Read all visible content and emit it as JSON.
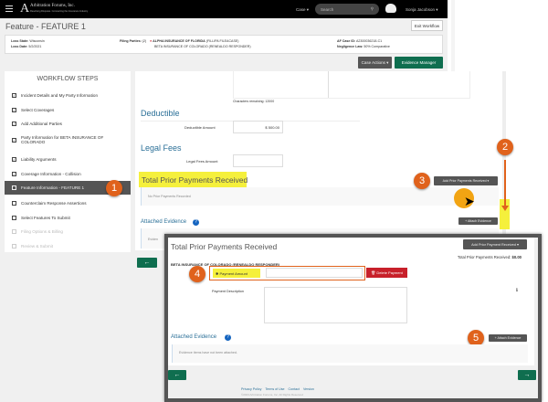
{
  "topbar": {
    "logo": "Arbitration Forums, Inc.",
    "tagline": "Resolving Disputes. Connecting the Insurance Industry",
    "case_menu": "Case ▾",
    "search_placeholder": "Search",
    "user": "Sonja Jacobson ▾"
  },
  "header": {
    "title": "Feature - FEATURE 1",
    "exit": "Exit Workflow"
  },
  "info": {
    "loss_state_label": "Loss State:",
    "loss_state": "Wisconsin",
    "loss_date_label": "Loss Date:",
    "loss_date": "5/2/2021",
    "filing_label": "Filing Parties:",
    "filing_count": "(2)",
    "party1": "ALPHA INSURANCE OF FLORIDA",
    "party1_rep": "(FILLIPA FILEACASE)",
    "party2": "BETA INSURANCE OF COLORADO",
    "party2_rep": "(RENEALDO RESPONDER)",
    "case_id_label": "AF Case ID:",
    "case_id": "A2300036218-C1",
    "negligence_label": "Negligence Law:",
    "negligence": "50% Comparative"
  },
  "actions": {
    "case_actions": "Case Actions ▾",
    "evidence_manager": "Evidence Manager"
  },
  "sidebar": {
    "title": "WORKFLOW STEPS",
    "items": [
      {
        "label": "Incident Details and My Party Information",
        "checked": true
      },
      {
        "label": "Select Coverages",
        "checked": true
      },
      {
        "label": "Add Additional Parties",
        "checked": true
      },
      {
        "label": "Party Information for BETA INSURANCE OF COLORADO",
        "checked": true
      },
      {
        "label": "Liability Arguments",
        "checked": true
      },
      {
        "label": "Coverage Information - Collision",
        "checked": true
      },
      {
        "label": "Feature Information - FEATURE 1",
        "checked": false,
        "active": true
      },
      {
        "label": "Counterclaim Response Assertions",
        "checked": false
      },
      {
        "label": "Select Features To Submit",
        "checked": false
      },
      {
        "label": "Filing Options & Billing",
        "checked": false,
        "disabled": true
      },
      {
        "label": "Review & Submit",
        "checked": false,
        "disabled": true
      }
    ]
  },
  "main": {
    "chars_remaining": "Characters remaining: 12000",
    "deductible": "Deductible",
    "deductible_amount_label": "Deductible Amount",
    "deductible_amount": "$ 500.00",
    "legal_fees": "Legal Fees",
    "legal_fees_label": "Legal Fees Amount",
    "prior_payments": "Total Prior Payments Received",
    "add_prior": "Add Prior Payments Received ▾",
    "no_prior": "No Prior Payments Recorded",
    "attached": "Attached Evidence",
    "attach_btn": "+ Attach Evidence",
    "evidence_stub": "Eviden"
  },
  "overlay": {
    "title": "Total Prior Payments Received",
    "add_prior": "Add Prior Payment Received ▾",
    "total_label": "Total Prior Payments Received:",
    "total": "$0.00",
    "party": "BETA INSURANCE OF COLORADO (RENEALDO RESPONDER)",
    "payment_amount": "Payment Amount",
    "delete": "Delete Payment",
    "payment_desc": "Payment Description",
    "attached": "Attached Evidence",
    "attach_btn": "+ Attach Evidence",
    "no_evidence": "Evidence items have not been attached.",
    "footer_links": [
      "Privacy Policy",
      "Terms of Use",
      "Contact",
      "Version"
    ],
    "copyright": "©2023 Arbitration Forums, Inc. All Rights Reserved"
  },
  "callouts": [
    "1",
    "2",
    "3",
    "4",
    "5"
  ],
  "colors": {
    "callout": "#e0621c",
    "highlight": "#f5f03c",
    "green": "#0f6e4f",
    "delete": "#c8202a"
  }
}
